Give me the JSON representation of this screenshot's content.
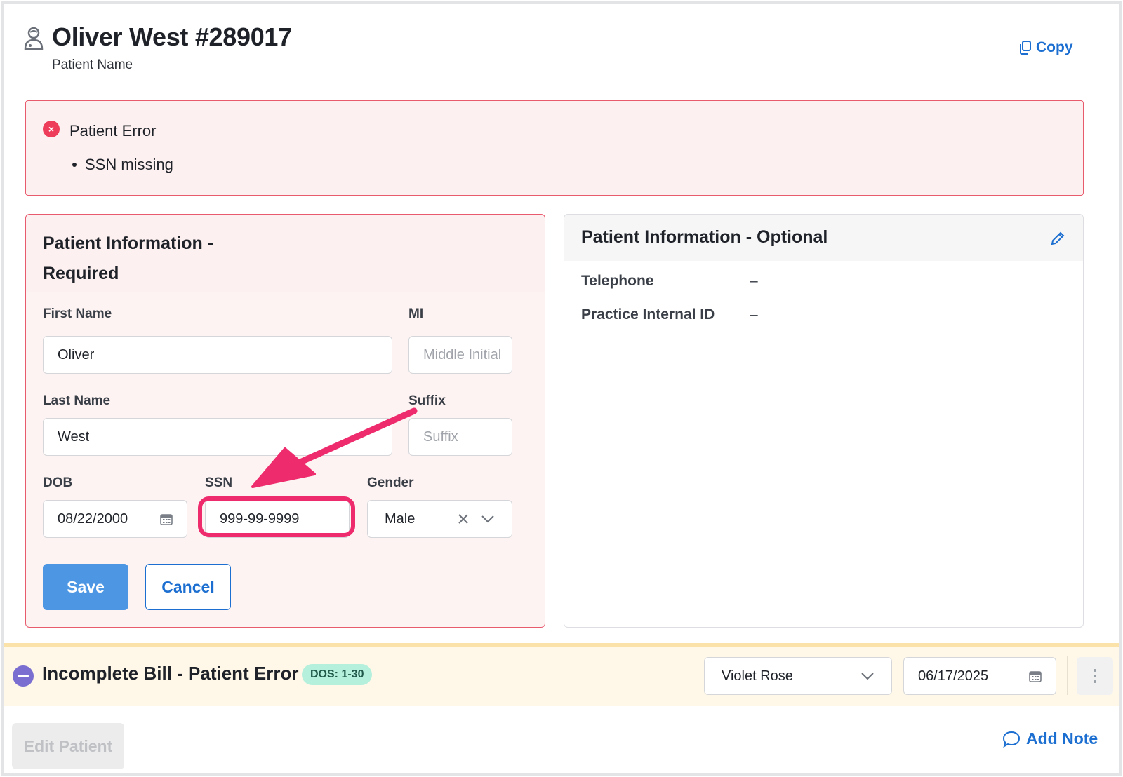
{
  "header": {
    "title": "Oliver West #289017",
    "subtitle": "Patient Name",
    "copy_label": "Copy",
    "user_icon": "patient-icon",
    "copy_icon": "copy-icon"
  },
  "alert": {
    "title": "Patient Error",
    "items": [
      "SSN missing"
    ],
    "color": "#ee3d5a"
  },
  "required_card": {
    "title": "Patient Information - Required",
    "first_name": {
      "label": "First Name",
      "value": "Oliver"
    },
    "mi": {
      "label": "MI",
      "placeholder": "Middle Initial"
    },
    "last_name": {
      "label": "Last Name",
      "value": "West"
    },
    "suffix": {
      "label": "Suffix",
      "placeholder": "Suffix"
    },
    "dob": {
      "label": "DOB",
      "value": "08/22/2000"
    },
    "ssn": {
      "label": "SSN",
      "value": "999-99-9999"
    },
    "gender": {
      "label": "Gender",
      "value": "Male"
    },
    "save_label": "Save",
    "cancel_label": "Cancel"
  },
  "optional_card": {
    "title": "Patient Information - Optional",
    "rows": [
      {
        "label": "Telephone",
        "value": "–"
      },
      {
        "label": "Practice Internal ID",
        "value": "–"
      }
    ]
  },
  "bill": {
    "title": "Incomplete Bill - Patient Error",
    "dos_badge": "DOS: 1-30",
    "provider": "Violet Rose",
    "date": "06/17/2025"
  },
  "footer": {
    "edit_label": "Edit Patient",
    "add_note_label": "Add Note"
  },
  "colors": {
    "accent": "#1c6fd0",
    "error": "#e85a6e",
    "highlight": "#ee2b6c",
    "save": "#4c96e3"
  }
}
